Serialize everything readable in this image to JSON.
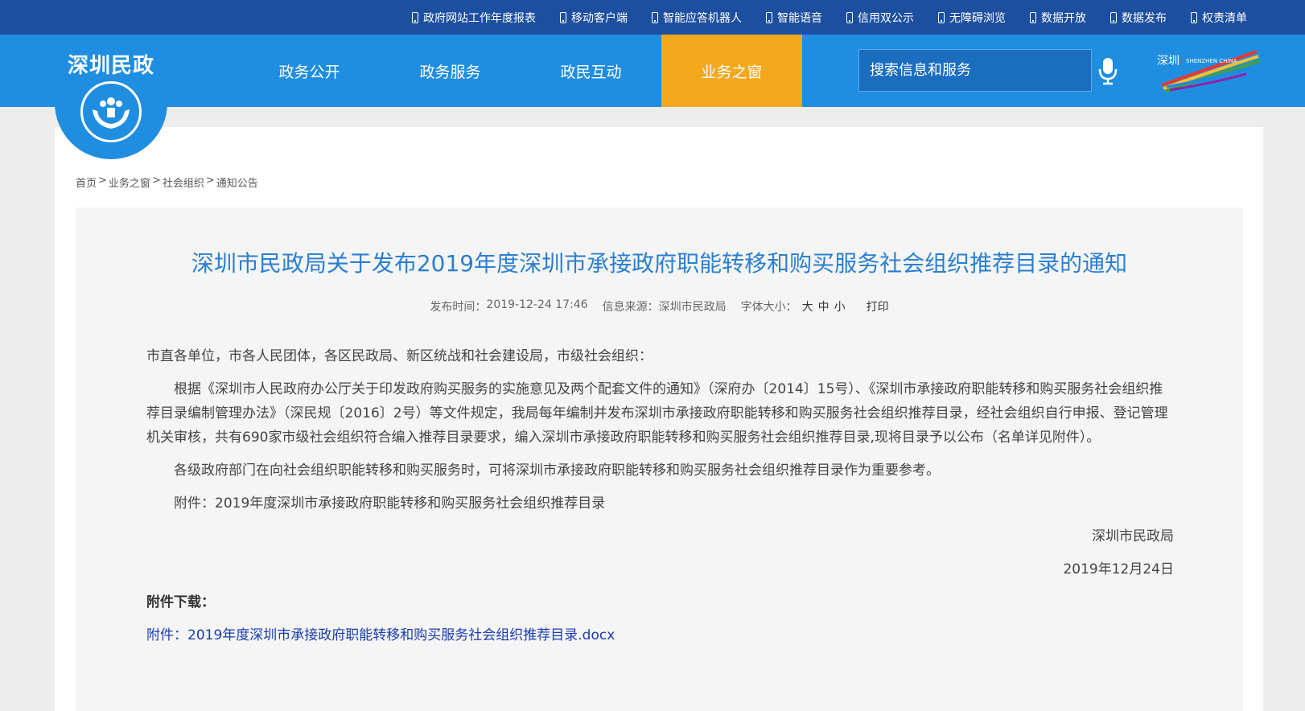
{
  "topbar": {
    "links": [
      {
        "label": "政府网站工作年度报表"
      },
      {
        "label": "移动客户端"
      },
      {
        "label": "智能应答机器人"
      },
      {
        "label": "智能语音"
      },
      {
        "label": "信用双公示"
      },
      {
        "label": "无障碍浏览"
      },
      {
        "label": "数据开放"
      },
      {
        "label": "数据发布"
      },
      {
        "label": "权责清单"
      }
    ]
  },
  "logo": {
    "text": "深圳民政"
  },
  "nav": {
    "items": [
      {
        "label": "政务公开"
      },
      {
        "label": "政务服务"
      },
      {
        "label": "政民互动"
      },
      {
        "label": "业务之窗",
        "active": true
      }
    ]
  },
  "search": {
    "placeholder": "搜索信息和服务"
  },
  "breadcrumb": [
    "首页",
    "业务之窗",
    "社会组织",
    "通知公告"
  ],
  "breadcrumb_sep": ">",
  "article": {
    "title": "深圳市民政局关于发布2019年度深圳市承接政府职能转移和购买服务社会组织推荐目录的通知",
    "meta": {
      "publish_label": "发布时间：",
      "publish_time": "2019-12-24  17:46",
      "source_label": "信息来源：",
      "source": "深圳市民政局",
      "font_label": "字体大小：",
      "font_large": "大",
      "font_medium": "中",
      "font_small": "小",
      "print": "打印"
    },
    "salutation": "市直各单位，市各人民团体，各区民政局、新区统战和社会建设局，市级社会组织：",
    "para1": "根据《深圳市人民政府办公厅关于印发政府购买服务的实施意见及两个配套文件的通知》（深府办〔2014〕15号）、《深圳市承接政府职能转移和购买服务社会组织推荐目录编制管理办法》（深民规〔2016〕2号）等文件规定，我局每年编制并发布深圳市承接政府职能转移和购买服务社会组织推荐目录，经社会组织自行申报、登记管理机关审核，共有690家市级社会组织符合编入推荐目录要求，编入深圳市承接政府职能转移和购买服务社会组织推荐目录,现将目录予以公布（名单详见附件）。",
    "para2": "各级政府部门在向社会组织职能转移和购买服务时，可将深圳市承接政府职能转移和购买服务社会组织推荐目录作为重要参考。",
    "para3": "附件：2019年度深圳市承接政府职能转移和购买服务社会组织推荐目录",
    "signature": "深圳市民政局",
    "date": "2019年12月24日",
    "download_label": "附件下载：",
    "download_link": "附件：2019年度深圳市承接政府职能转移和购买服务社会组织推荐目录.docx"
  },
  "colors": {
    "topbar": "#1d4fa0",
    "navbar": "#1f8ee0",
    "active_nav": "#f4a81d",
    "title": "#2b7fd0",
    "link": "#1a3cb0"
  }
}
